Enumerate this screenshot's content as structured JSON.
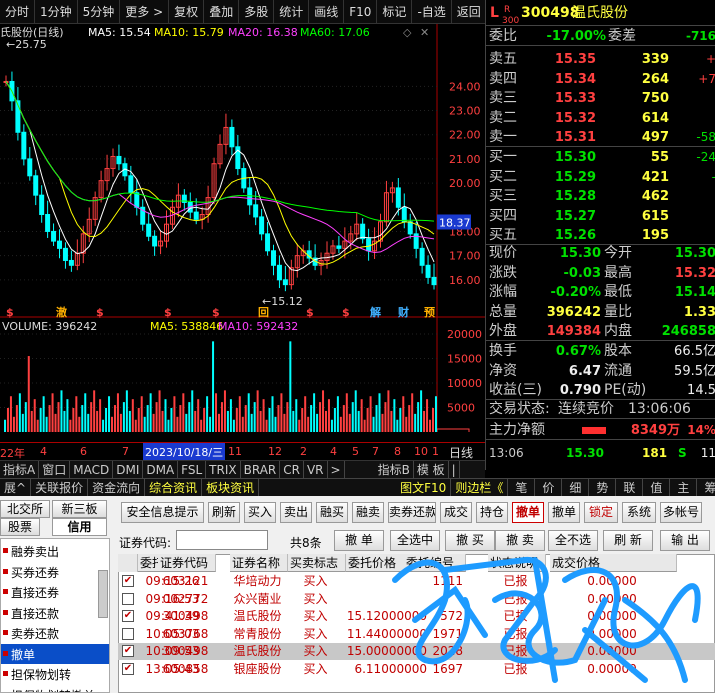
{
  "toolbar": {
    "items": [
      "分时",
      "1分钟",
      "5分钟",
      "更多 >",
      "复权",
      "叠加",
      "多股",
      "统计",
      "画线",
      "F10",
      "标记",
      "-自选",
      "返回"
    ]
  },
  "chart": {
    "title": "氏股份(日线)",
    "ma5_label": "MA5: 15.54",
    "ma10_label": "MA10: 15.79",
    "ma20_label": "MA20: 16.38",
    "ma60_label": "MA60: 17.06",
    "high_marker": "25.75",
    "low_marker": "15.12",
    "current_price_tag": "18.37",
    "price_ticks": [
      "24.00",
      "23.00",
      "22.00",
      "21.00",
      "20.00",
      "18.00",
      "17.00",
      "16.00"
    ],
    "event_markers": [
      "$",
      "澈",
      "$",
      "$",
      "$",
      "回",
      "$",
      "$",
      "解",
      "财",
      "预"
    ],
    "volume_label": "VOLUME: 396242",
    "vol_ma5_label": "MA5: 538846",
    "vol_ma10_label": "MA10: 592432",
    "volume_ticks": [
      "20000",
      "15000",
      "10000",
      "5000"
    ],
    "volume_unit": "X100",
    "date_axis": [
      "22年",
      "4",
      "6",
      "7",
      "8",
      "9",
      "11",
      "12",
      "2",
      "4",
      "5",
      "7",
      "8",
      "10",
      "1"
    ],
    "cursor_date": "2023/10/18/三",
    "period_button": "日线"
  },
  "chart_data": {
    "type": "candlestick",
    "title": "温氏股份(日线)",
    "price_ylim": [
      15.0,
      25.75
    ],
    "series": [
      {
        "name": "MA5",
        "value": 15.54
      },
      {
        "name": "MA10",
        "value": 15.79
      },
      {
        "name": "MA20",
        "value": 16.38
      },
      {
        "name": "MA60",
        "value": 17.06
      }
    ],
    "close_series": [
      24.2,
      23.4,
      22.1,
      21.0,
      20.3,
      19.5,
      18.7,
      18.0,
      17.6,
      17.3,
      16.8,
      16.6,
      17.1,
      17.9,
      18.5,
      19.4,
      20.1,
      20.6,
      21.1,
      20.8,
      20.3,
      19.6,
      19.0,
      18.3,
      17.8,
      17.4,
      17.6,
      18.3,
      19.0,
      19.5,
      19.2,
      18.8,
      18.5,
      18.7,
      19.4,
      20.8,
      21.6,
      22.3,
      21.5,
      20.6,
      19.8,
      19.1,
      18.6,
      17.9,
      17.2,
      16.6,
      16.0,
      15.8,
      16.5,
      17.0,
      17.2,
      16.9,
      16.6,
      16.8,
      17.1,
      17.4,
      17.3,
      17.6,
      17.9,
      18.3,
      17.7,
      17.2,
      17.6,
      18.4,
      19.6,
      19.8,
      19.0,
      18.4,
      17.9,
      17.3,
      16.6,
      16.1,
      15.8
    ],
    "volume": {
      "latest": 396242,
      "ma5": 538846,
      "ma10": 592432,
      "ylim": [
        0,
        20000
      ],
      "unit": "X100"
    }
  },
  "quote": {
    "stock_code": "300498",
    "stock_name": "温氏股份",
    "weibi_label": "委比",
    "weibi_value": "-17.00%",
    "weicha_label": "委差",
    "weicha_value": "-716",
    "asks": [
      {
        "label": "卖五",
        "price": "15.35",
        "vol": "339",
        "chg": "+"
      },
      {
        "label": "卖四",
        "price": "15.34",
        "vol": "264",
        "chg": "+7"
      },
      {
        "label": "卖三",
        "price": "15.33",
        "vol": "750",
        "chg": ""
      },
      {
        "label": "卖二",
        "price": "15.32",
        "vol": "614",
        "chg": ""
      },
      {
        "label": "卖一",
        "price": "15.31",
        "vol": "497",
        "chg": "-58"
      }
    ],
    "bids": [
      {
        "label": "买一",
        "price": "15.30",
        "vol": "55",
        "chg": "-24"
      },
      {
        "label": "买二",
        "price": "15.29",
        "vol": "421",
        "chg": "-"
      },
      {
        "label": "买三",
        "price": "15.28",
        "vol": "462",
        "chg": ""
      },
      {
        "label": "买四",
        "price": "15.27",
        "vol": "615",
        "chg": ""
      },
      {
        "label": "买五",
        "price": "15.26",
        "vol": "195",
        "chg": ""
      }
    ],
    "stats": [
      {
        "l1": "现价",
        "v1": "15.30",
        "l2": "今开",
        "v2": "15.30"
      },
      {
        "l1": "涨跌",
        "v1": "-0.03",
        "l2": "最高",
        "v2": "15.32"
      },
      {
        "l1": "涨幅",
        "v1": "-0.20%",
        "l2": "最低",
        "v2": "15.14"
      },
      {
        "l1": "总量",
        "v1": "396242",
        "l2": "量比",
        "v2": "1.33"
      },
      {
        "l1": "外盘",
        "v1": "149384",
        "l2": "内盘",
        "v2": "246858"
      }
    ],
    "stats2": [
      {
        "l1": "换手",
        "v1": "0.67%",
        "l2": "股本",
        "v2": "66.5亿"
      },
      {
        "l1": "净资",
        "v1": "6.47",
        "l2": "流通",
        "v2": "59.5亿"
      },
      {
        "l1": "收益(三)",
        "v1": "0.790",
        "l2": "PE(动)",
        "v2": "14.5"
      }
    ],
    "trade_status_label": "交易状态:",
    "trade_status": "连续竞价",
    "trade_time": "13:06:06",
    "net_label": "主力净额",
    "net_value": "8349万",
    "net_pct": "14%",
    "tick": {
      "time": "13:06",
      "price": "15.30",
      "vol": "181",
      "flag": "S",
      "num": "11"
    }
  },
  "indicators": [
    "指标A",
    "窗口",
    "MACD",
    "DMI",
    "DMA",
    "FSL",
    "TRIX",
    "BRAR",
    "CR",
    "VR",
    ">",
    "指标B",
    "模 板",
    "|"
  ],
  "bottom_tabs": [
    "展^",
    "关联报价",
    "资金流向",
    "综合资讯",
    "板块资讯",
    "图文F10",
    "则边栏《",
    "笔",
    "价",
    "细",
    "势",
    "联",
    "值",
    "主",
    "筹"
  ],
  "trade": {
    "left_tabs": [
      "北交所",
      "新三板",
      "股票",
      "信用"
    ],
    "sidebar_items": [
      "融券卖出",
      "买券还券",
      "直接还券",
      "直接还款",
      "卖券还款",
      "撤单",
      "担保物划转",
      "担保物划转撤单"
    ],
    "top_buttons": [
      "安全信息提示",
      "刷新",
      "买入",
      "卖出",
      "融买",
      "融卖",
      "卖券还款",
      "成交",
      "持仓",
      "撤单",
      "撤单",
      "锁定",
      "系统",
      "多帐号"
    ],
    "code_label": "证券代码:",
    "code_placeholder": "",
    "count_label": "共8条",
    "action_buttons": [
      "撤 单",
      "全选中",
      "撤 买",
      "撤 卖",
      "全不选",
      "刷 新",
      "输 出"
    ],
    "headers": [
      "委托时间",
      "证券代码",
      "证券名称",
      "买卖标志",
      "委托价格",
      "委托编号",
      "状态说明",
      "成交价格"
    ],
    "rows": [
      {
        "checked": true,
        "time": "09:15:26",
        "code": "603121",
        "name": "华培动力",
        "side": "买入",
        "price": "",
        "id": "1111",
        "status": "已报",
        "deal": "0.00000"
      },
      {
        "checked": false,
        "time": "09:16:53",
        "code": "002772",
        "name": "众兴菌业",
        "side": "买入",
        "price": "",
        "id": "",
        "status": "已报",
        "deal": "0.00000"
      },
      {
        "checked": true,
        "time": "09:41:39",
        "code": "300498",
        "name": "温氏股份",
        "side": "买入",
        "price": "15.12000000",
        "id": "572",
        "status": "已报",
        "deal": "0.00000"
      },
      {
        "checked": false,
        "time": "10:05:03",
        "code": "603768",
        "name": "常青股份",
        "side": "买入",
        "price": "11.44000000",
        "id": "1971",
        "status": "已报",
        "deal": "0.00000"
      },
      {
        "checked": true,
        "time": "10:09:53",
        "code": "300498",
        "name": "温氏股份",
        "side": "买入",
        "price": "15.00000000",
        "id": "2028",
        "status": "已报",
        "deal": "0.00000"
      },
      {
        "checked": true,
        "time": "13:05:43",
        "code": "600858",
        "name": "银座股份",
        "side": "买入",
        "price": "6.11000000",
        "id": "1697",
        "status": "已报",
        "deal": "0.00000"
      }
    ]
  },
  "colors": {
    "up": "#ff4040",
    "down": "#00ffff",
    "ma5": "#ffffff",
    "ma10": "#ffff00",
    "ma20": "#ff40ff",
    "ma60": "#00ff00",
    "accent": "#c00000"
  }
}
